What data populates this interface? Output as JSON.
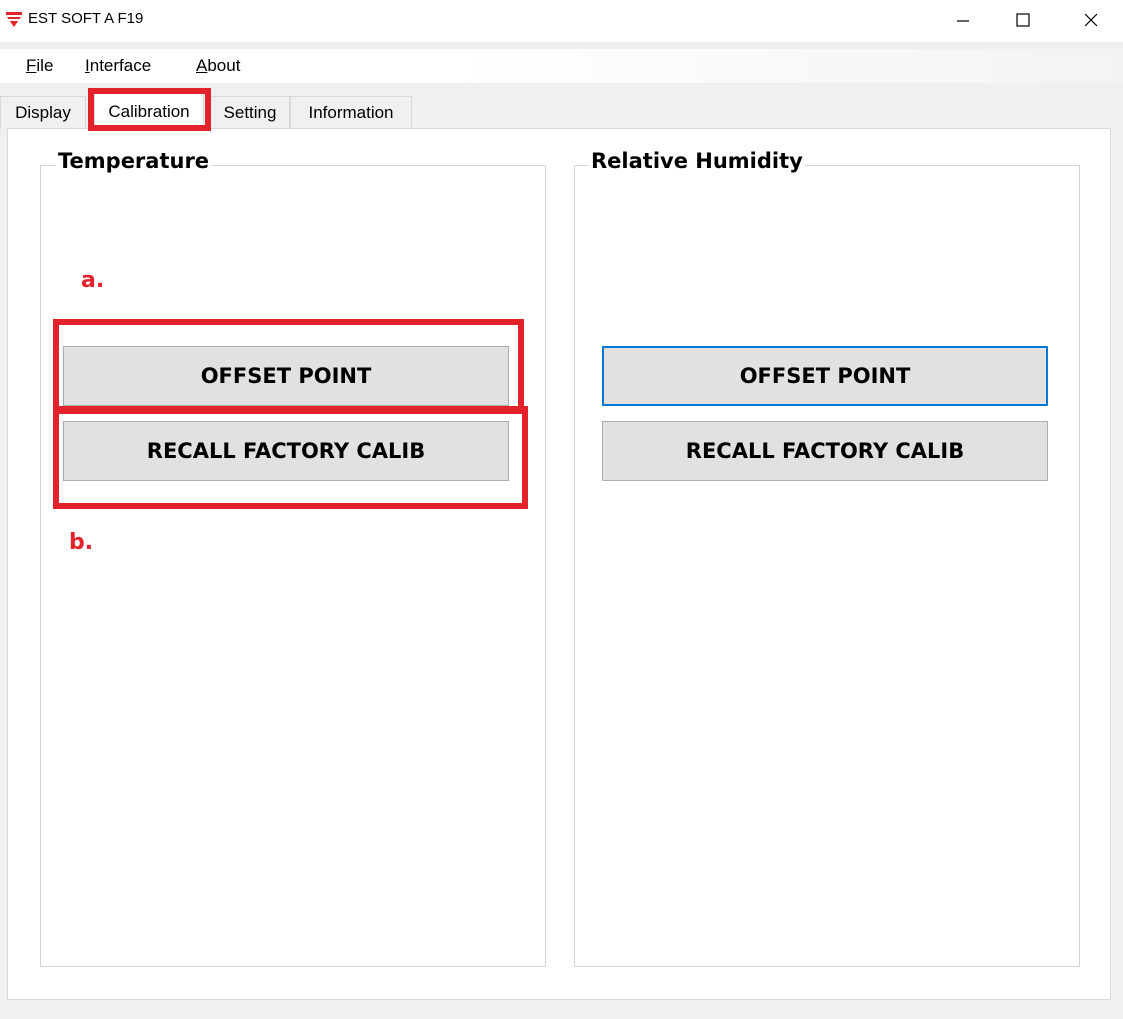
{
  "window": {
    "title": "EST SOFT A F19",
    "minimize_glyph": "—",
    "close_glyph": "✕"
  },
  "menu": {
    "file": {
      "mnemonic": "F",
      "rest": "ile"
    },
    "interface": {
      "mnemonic": "I",
      "rest": "nterface"
    },
    "about": {
      "mnemonic": "A",
      "rest": "bout"
    }
  },
  "tabs": [
    {
      "label": "Display"
    },
    {
      "label": "Calibration",
      "active": true
    },
    {
      "label": "Setting"
    },
    {
      "label": "Information"
    }
  ],
  "temperature": {
    "title": "Temperature",
    "offset_label": "OFFSET POINT",
    "recall_label": "RECALL FACTORY CALIB"
  },
  "humidity": {
    "title": "Relative Humidity",
    "offset_label": "OFFSET POINT",
    "recall_label": "RECALL FACTORY CALIB"
  },
  "annotations": {
    "a": "a.",
    "b": "b."
  },
  "colors": {
    "annotation_red": "#e3232b",
    "focus_blue": "#0078d7",
    "logo_red": "#e3232b"
  },
  "icons": {
    "logo": "app-logo-icon",
    "minimize": "minimize-icon",
    "maximize": "maximize-icon",
    "close": "close-icon"
  }
}
